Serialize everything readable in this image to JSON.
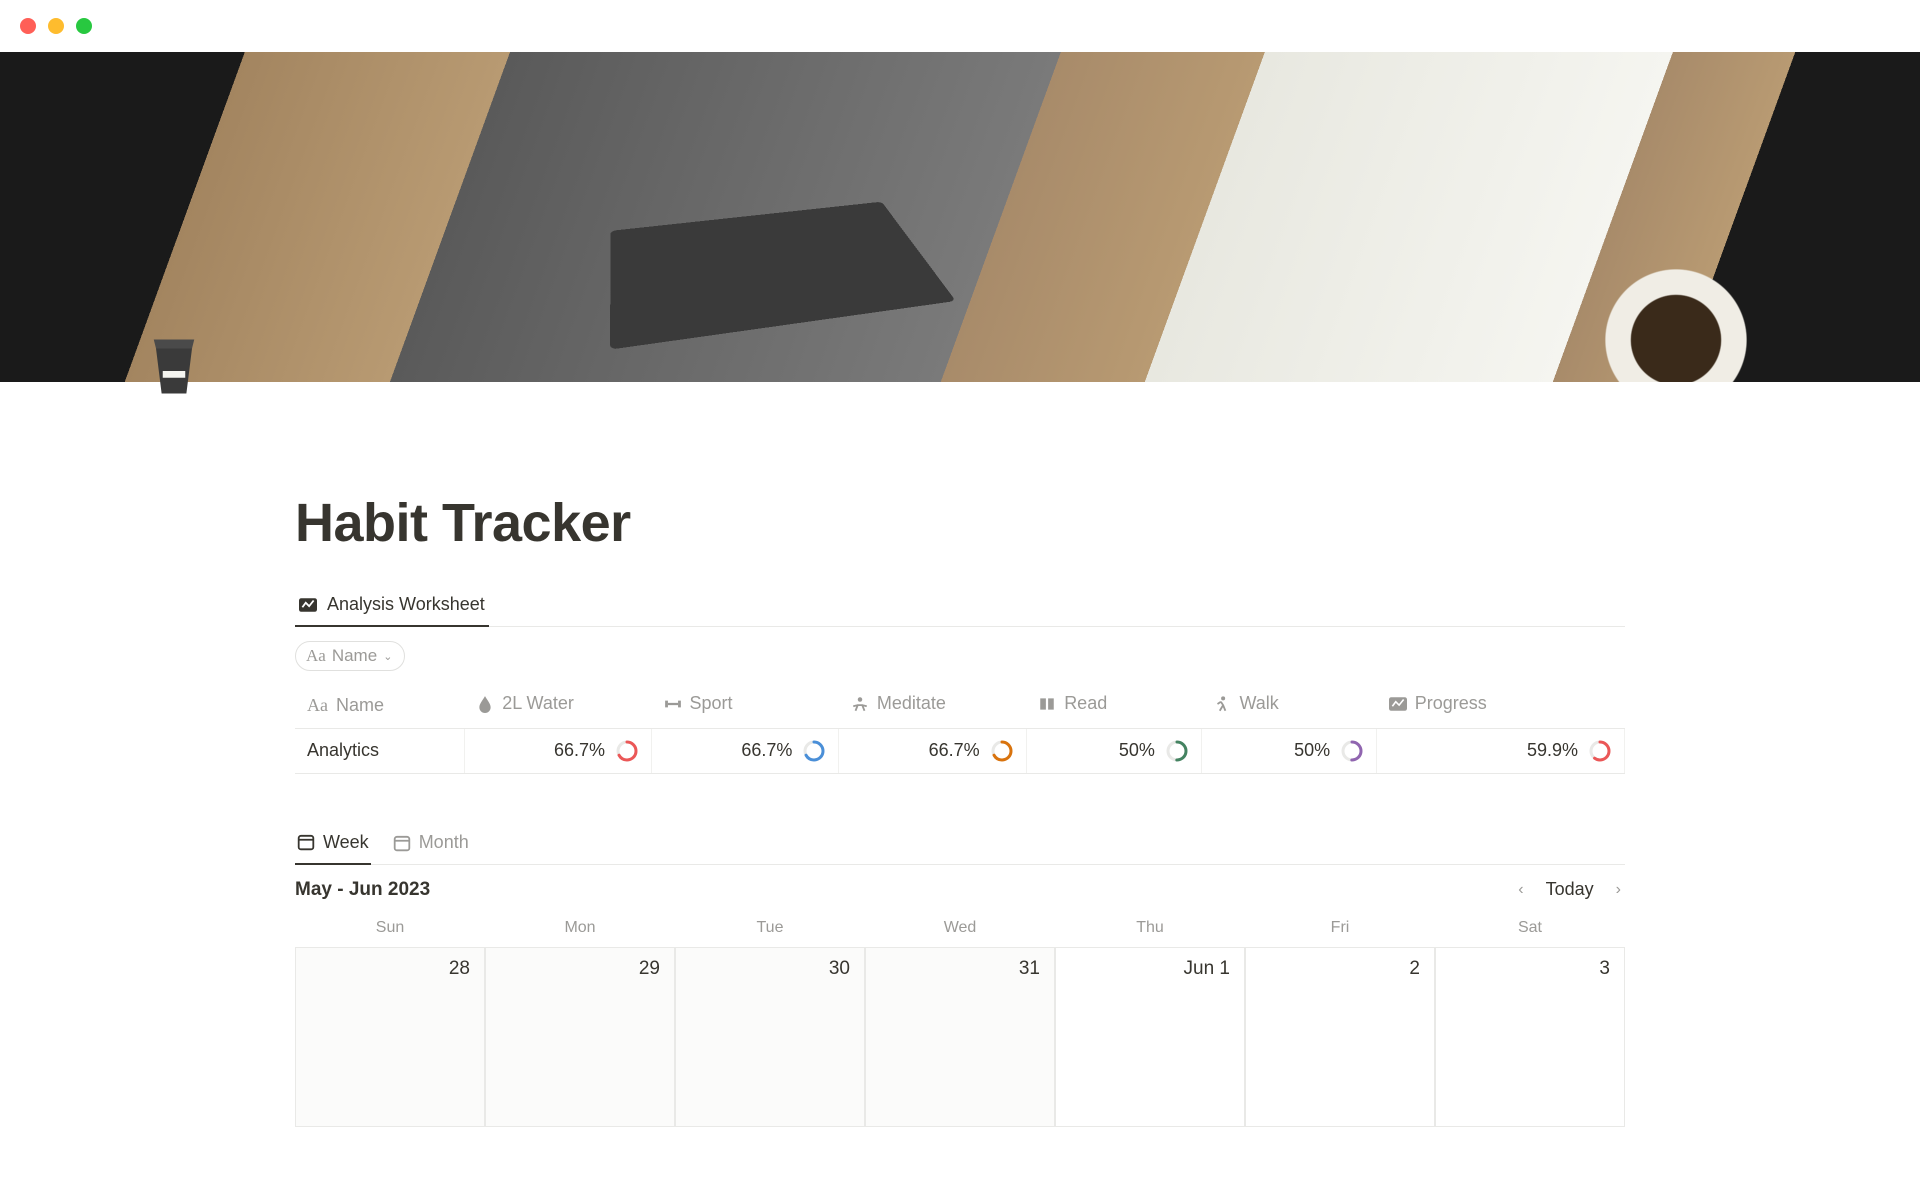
{
  "page": {
    "title": "Habit Tracker"
  },
  "analysis": {
    "tab_label": "Analysis Worksheet",
    "filter": {
      "label": "Name"
    },
    "columns": [
      {
        "key": "name",
        "label": "Name"
      },
      {
        "key": "water",
        "label": "2L Water"
      },
      {
        "key": "sport",
        "label": "Sport"
      },
      {
        "key": "meditate",
        "label": "Meditate"
      },
      {
        "key": "read",
        "label": "Read"
      },
      {
        "key": "walk",
        "label": "Walk"
      },
      {
        "key": "progress",
        "label": "Progress"
      }
    ],
    "row": {
      "name": "Analytics",
      "water": {
        "pct": "66.7%",
        "value": 0.667,
        "color": "#eb5757"
      },
      "sport": {
        "pct": "66.7%",
        "value": 0.667,
        "color": "#4a8fd8"
      },
      "meditate": {
        "pct": "66.7%",
        "value": 0.667,
        "color": "#d9730d"
      },
      "read": {
        "pct": "50%",
        "value": 0.5,
        "color": "#448361"
      },
      "walk": {
        "pct": "50%",
        "value": 0.5,
        "color": "#9065b0"
      },
      "progress": {
        "pct": "59.9%",
        "value": 0.599,
        "color": "#eb5757"
      }
    }
  },
  "calendar": {
    "tabs": {
      "week": "Week",
      "month": "Month"
    },
    "range": "May - Jun 2023",
    "today_label": "Today",
    "day_headers": [
      "Sun",
      "Mon",
      "Tue",
      "Wed",
      "Thu",
      "Fri",
      "Sat"
    ],
    "days": [
      {
        "label": "28",
        "other": true
      },
      {
        "label": "29",
        "other": true
      },
      {
        "label": "30",
        "other": true
      },
      {
        "label": "31",
        "other": true
      },
      {
        "label": "Jun 1",
        "other": false
      },
      {
        "label": "2",
        "other": false
      },
      {
        "label": "3",
        "other": false
      }
    ]
  }
}
